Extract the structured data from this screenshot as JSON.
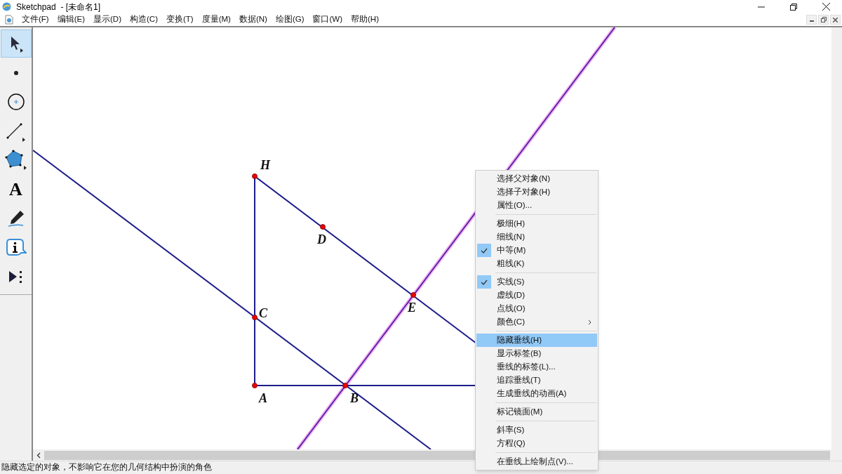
{
  "window": {
    "title": "Sketchpad  - [未命名1]"
  },
  "menu": [
    "文件(F)",
    "编辑(E)",
    "显示(D)",
    "构造(C)",
    "变换(T)",
    "度量(M)",
    "数据(N)",
    "绘图(G)",
    "窗口(W)",
    "帮助(H)"
  ],
  "toolbar": [
    {
      "kind": "select",
      "selected": true
    },
    {
      "kind": "point",
      "selected": false
    },
    {
      "kind": "compass",
      "selected": false
    },
    {
      "kind": "line",
      "selected": false
    },
    {
      "kind": "polygon",
      "selected": false
    },
    {
      "kind": "text",
      "selected": false,
      "glyph": "A"
    },
    {
      "kind": "marker",
      "selected": false
    },
    {
      "kind": "info",
      "selected": false
    },
    {
      "kind": "custom",
      "selected": false
    }
  ],
  "canvas": {
    "points": [
      {
        "label": "H"
      },
      {
        "label": "D"
      },
      {
        "label": "C"
      },
      {
        "label": "E"
      },
      {
        "label": "A"
      },
      {
        "label": "B"
      }
    ]
  },
  "context_menu": {
    "groups": [
      [
        {
          "label": "选择父对象(N)"
        },
        {
          "label": "选择子对象(H)"
        },
        {
          "label": "属性(O)..."
        }
      ],
      [
        {
          "label": "极细(H)",
          "checked": false
        },
        {
          "label": "细线(N)",
          "checked": false
        },
        {
          "label": "中等(M)",
          "checked": true
        },
        {
          "label": "粗线(K)",
          "checked": false
        }
      ],
      [
        {
          "label": "实线(S)",
          "checked": true
        },
        {
          "label": "虚线(D)",
          "checked": false
        },
        {
          "label": "点线(O)",
          "checked": false
        },
        {
          "label": "颜色(C)",
          "checked": false,
          "submenu": true
        }
      ],
      [
        {
          "label": "隐藏垂线(H)",
          "selected": true
        },
        {
          "label": "显示标签(B)",
          "selected": false
        },
        {
          "label": "垂线的标签(L)...",
          "selected": false
        },
        {
          "label": "追踪垂线(T)",
          "selected": false
        },
        {
          "label": "生成垂线的动画(A)",
          "selected": false
        }
      ],
      [
        {
          "label": "标记镜面(M)"
        }
      ],
      [
        {
          "label": "斜率(S)"
        },
        {
          "label": "方程(Q)"
        }
      ],
      [
        {
          "label": "在垂线上绘制点(V)..."
        }
      ]
    ]
  },
  "status_bar": {
    "text": "隐藏选定的对象，不影响它在您的几何结构中扮演的角色"
  }
}
